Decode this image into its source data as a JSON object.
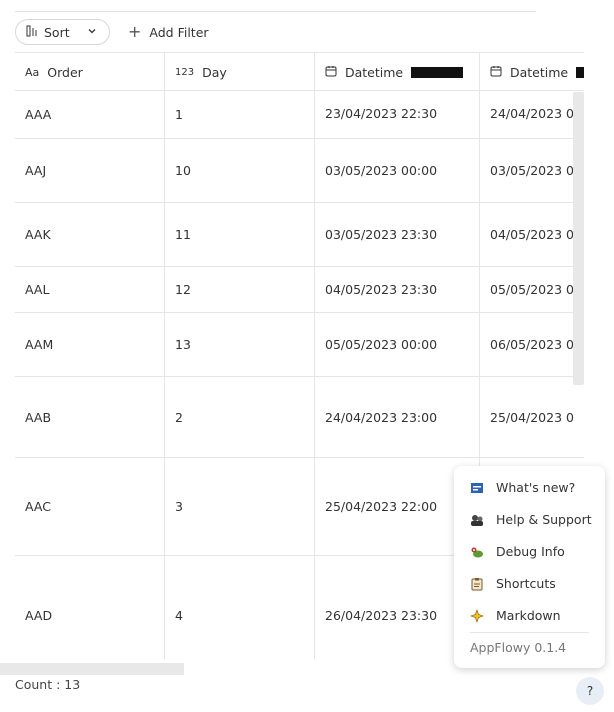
{
  "toolbar": {
    "sort_label": "Sort",
    "add_filter_label": "Add Filter",
    "sort_icon": "sort-icon",
    "chevron_icon": "chevron-down-icon",
    "plus_icon": "plus-icon"
  },
  "columns": [
    {
      "icon": "text-type-icon",
      "icon_glyph": "Aa",
      "label": "Order"
    },
    {
      "icon": "number-type-icon",
      "icon_glyph": "123",
      "label": "Day"
    },
    {
      "icon": "calendar-icon",
      "icon_glyph": "▢",
      "label": "Datetime"
    },
    {
      "icon": "calendar-icon",
      "icon_glyph": "▢",
      "label": "Datetime"
    }
  ],
  "rows": [
    {
      "order": "AAA",
      "day": "1",
      "dt1": "23/04/2023 22:30",
      "dt2": "24/04/2023 0"
    },
    {
      "order": "AAJ",
      "day": "10",
      "dt1": "03/05/2023 00:00",
      "dt2": "03/05/2023 0"
    },
    {
      "order": "AAK",
      "day": "11",
      "dt1": "03/05/2023 23:30",
      "dt2": "04/05/2023 0"
    },
    {
      "order": "AAL",
      "day": "12",
      "dt1": "04/05/2023 23:30",
      "dt2": "05/05/2023 0"
    },
    {
      "order": "AAM",
      "day": "13",
      "dt1": "05/05/2023 00:00",
      "dt2": "06/05/2023 0"
    },
    {
      "order": "AAB",
      "day": "2",
      "dt1": "24/04/2023 23:00",
      "dt2": "25/04/2023 0"
    },
    {
      "order": "AAC",
      "day": "3",
      "dt1": "25/04/2023 22:00",
      "dt2": ""
    },
    {
      "order": "AAD",
      "day": "4",
      "dt1": "26/04/2023 23:30",
      "dt2": ""
    }
  ],
  "footer": {
    "count_label": "Count : 13"
  },
  "help_menu": {
    "items": [
      {
        "label": "What's new?",
        "icon": "news-icon"
      },
      {
        "label": "Help & Support",
        "icon": "support-icon"
      },
      {
        "label": "Debug Info",
        "icon": "bug-icon"
      },
      {
        "label": "Shortcuts",
        "icon": "clipboard-icon"
      },
      {
        "label": "Markdown",
        "icon": "sparkle-icon"
      }
    ],
    "version": "AppFlowy 0.1.4"
  },
  "help_button": {
    "label": "?"
  },
  "colors": {
    "border": "#e6e6e6",
    "text": "#333333",
    "menu_shadow": "rgba(0,0,0,0.18)"
  }
}
